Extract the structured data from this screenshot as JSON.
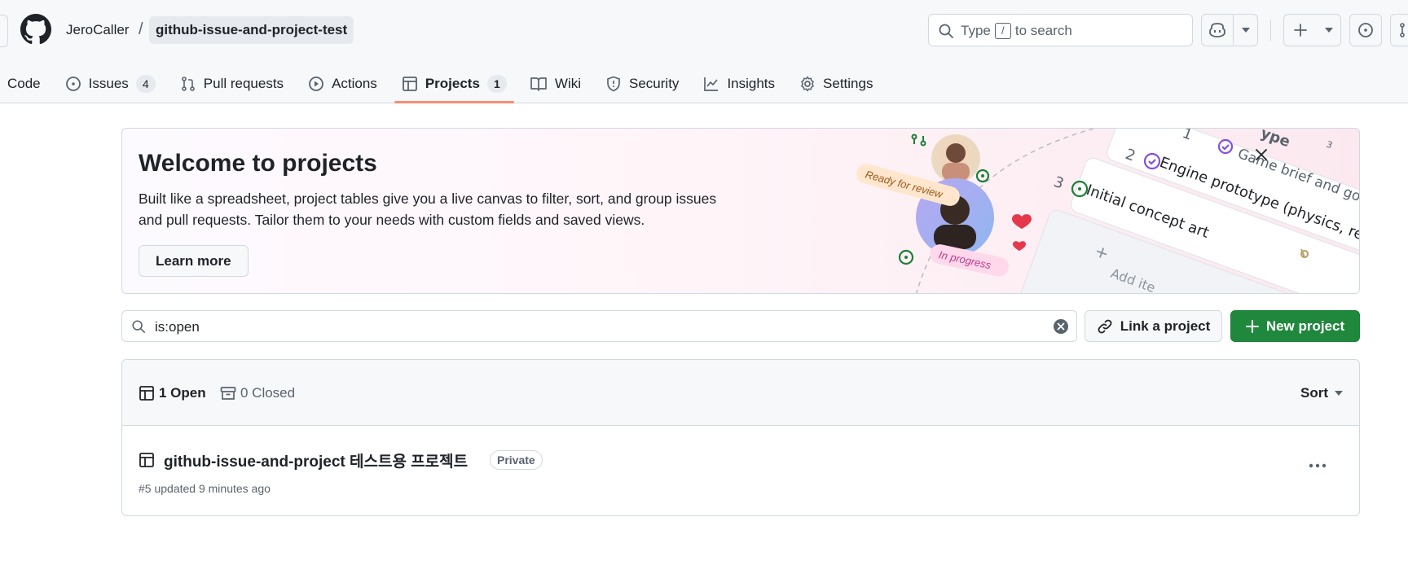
{
  "header": {
    "owner": "JeroCaller",
    "separator": "/",
    "repo": "github-issue-and-project-test",
    "search": {
      "prefix": "Type",
      "key": "/",
      "suffix": "to search"
    }
  },
  "tabs": [
    {
      "label": "Code",
      "icon": "code-icon"
    },
    {
      "label": "Issues",
      "icon": "issue-opened-icon",
      "count": "4"
    },
    {
      "label": "Pull requests",
      "icon": "git-pull-request-icon"
    },
    {
      "label": "Actions",
      "icon": "play-icon"
    },
    {
      "label": "Projects",
      "icon": "table-icon",
      "count": "1",
      "active": true
    },
    {
      "label": "Wiki",
      "icon": "book-icon"
    },
    {
      "label": "Security",
      "icon": "shield-icon"
    },
    {
      "label": "Insights",
      "icon": "graph-icon"
    },
    {
      "label": "Settings",
      "icon": "gear-icon"
    }
  ],
  "banner": {
    "title": "Welcome to projects",
    "description": "Built like a spreadsheet, project tables give you a live canvas to filter, sort, and group issues and pull requests. Tailor them to your needs with custom fields and saved views.",
    "learn_more": "Learn more",
    "illustration": {
      "ready_label": "Ready for review",
      "progress_label": "In progress",
      "rows": [
        {
          "num": "1",
          "text": "Game brief and go-no-",
          "count": "3"
        },
        {
          "num": "2",
          "text": "Engine prototype (physics, renderin"
        },
        {
          "num": "3",
          "text": "Initial concept art"
        }
      ],
      "partial_header": "ype",
      "add_item": "Add ite"
    }
  },
  "filter": {
    "value": "is:open"
  },
  "actions": {
    "link_project": "Link a project",
    "new_project": "New project"
  },
  "list": {
    "open_label": "1 Open",
    "closed_label": "0 Closed",
    "sort_label": "Sort",
    "projects": [
      {
        "title": "github-issue-and-project 테스트용 프로젝트",
        "visibility": "Private",
        "meta": "#5 updated 9 minutes ago"
      }
    ]
  },
  "colors": {
    "primary_green": "#1f883d",
    "tab_underline": "#fd8c73",
    "border": "#d1d9e0",
    "muted_text": "#59636e"
  }
}
